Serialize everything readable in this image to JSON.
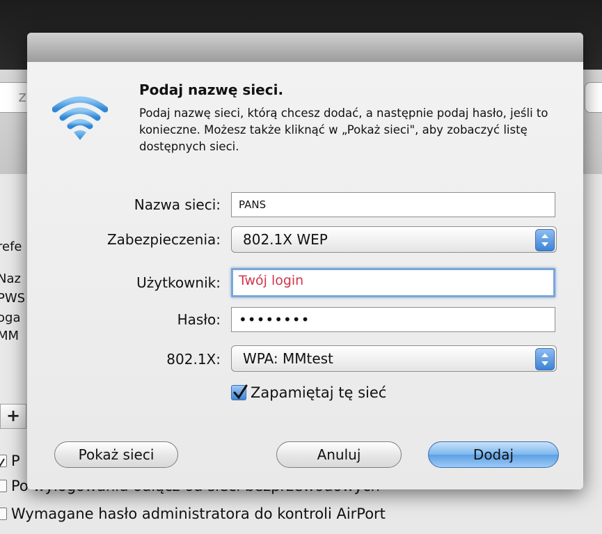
{
  "background": {
    "search_fragment": "zy",
    "left_fragments": [
      "refe",
      "Naz",
      "PWS",
      "oga",
      "MM"
    ],
    "plus_label": "+",
    "check_rows": [
      {
        "label": "P",
        "checked": true
      },
      {
        "label": "Po wylogowaniu odłącz od sieci bezprzewodowych",
        "checked": false
      },
      {
        "label": "Wymagane hasło administratora do kontroli AirPort",
        "checked": false
      }
    ]
  },
  "dialog": {
    "icon": "wifi-icon",
    "heading": "Podaj nazwę sieci.",
    "description": "Podaj nazwę sieci, którą chcesz dodać, a następnie podaj hasło, jeśli to konieczne. Możesz także kliknąć w „Pokaż sieci\", aby zobaczyć listę dostępnych sieci.",
    "network_name": {
      "label": "Nazwa sieci:",
      "value": "PANS"
    },
    "security": {
      "label": "Zabezpieczenia:",
      "value": "802.1X WEP"
    },
    "username": {
      "label": "Użytkownik:",
      "value": "Twój login"
    },
    "password": {
      "label": "Hasło:",
      "value": "••••••••"
    },
    "eap": {
      "label": "802.1X:",
      "value": "WPA: MMtest"
    },
    "remember": {
      "label": "Zapamiętaj tę sieć",
      "checked": true
    },
    "buttons": {
      "show_networks": "Pokaż sieci",
      "cancel": "Anuluj",
      "add": "Dodaj"
    }
  },
  "colors": {
    "accent": "#5c9fe4",
    "focus_ring": "#7aa5d9",
    "username_text": "#d0354d"
  }
}
